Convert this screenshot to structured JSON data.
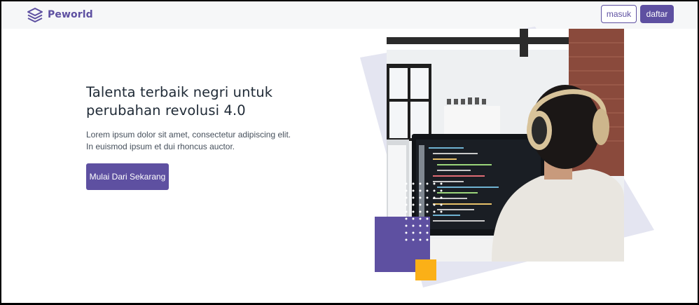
{
  "navbar": {
    "brand": "Peworld",
    "login_label": "masuk",
    "register_label": "daftar"
  },
  "hero": {
    "title": "Talenta terbaik negri untuk perubahan revolusi 4.0",
    "description": "Lorem ipsum dolor sit amet, consectetur adipiscing elit. In euismod ipsum et dui rhoncus auctor.",
    "cta_label": "Mulai Dari Sekarang"
  },
  "colors": {
    "primary": "#5e50a1",
    "accent": "#fbb017",
    "bg_shape": "#e4e5f1"
  }
}
